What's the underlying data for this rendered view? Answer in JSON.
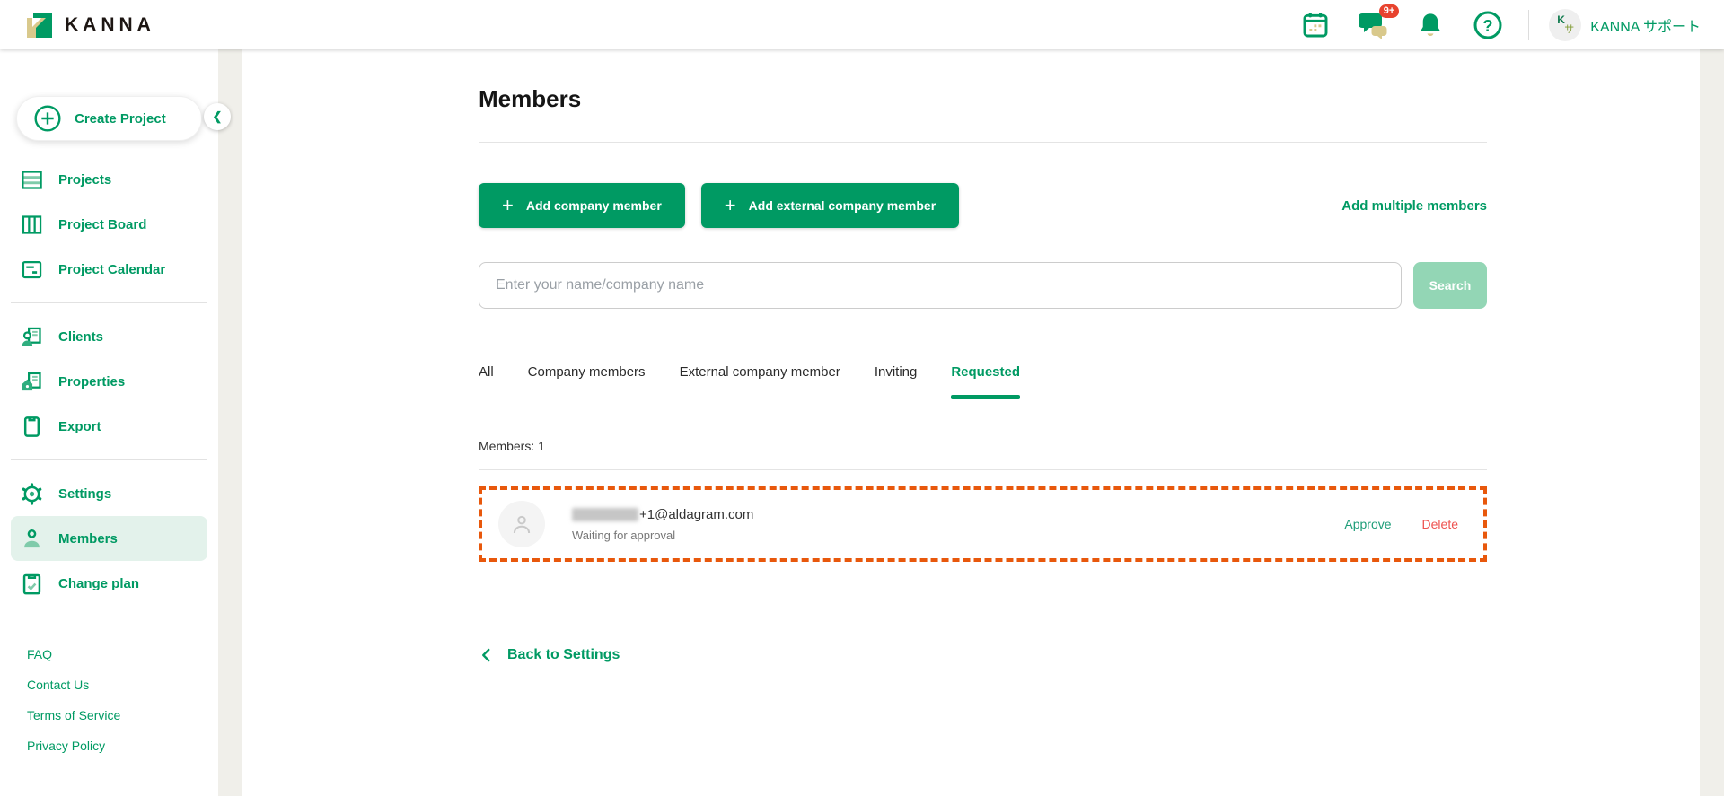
{
  "colors": {
    "brand_green": "#009A63",
    "disabled_green": "#93D6B5",
    "active_item_bg": "#E3F2EB",
    "dashed_orange": "#E8580C",
    "delete_red": "#EE5350",
    "badge_red": "#E8432E",
    "logo_tan": "#D9C98C"
  },
  "header": {
    "logo_text": "KANNA",
    "chat_badge": "9+",
    "avatar_char_1": "K",
    "avatar_char_2": "サ",
    "support_label": "KANNA サポート"
  },
  "sidebar": {
    "create_project_label": "Create Project",
    "nav_top": [
      {
        "label": "Projects",
        "icon": "projects-rows-icon"
      },
      {
        "label": "Project Board",
        "icon": "board-columns-icon"
      },
      {
        "label": "Project Calendar",
        "icon": "calendar-doc-icon"
      }
    ],
    "nav_mid": [
      {
        "label": "Clients",
        "icon": "client-person-doc-icon"
      },
      {
        "label": "Properties",
        "icon": "house-doc-icon"
      },
      {
        "label": "Export",
        "icon": "export-clipboard-icon"
      }
    ],
    "nav_bottom": [
      {
        "label": "Settings",
        "icon": "gear-icon",
        "active": false
      },
      {
        "label": "Members",
        "icon": "person-icon",
        "active": true
      },
      {
        "label": "Change plan",
        "icon": "clipboard-check-icon",
        "active": false
      }
    ],
    "footer_links": [
      {
        "label": "FAQ"
      },
      {
        "label": "Contact Us"
      },
      {
        "label": "Terms of Service"
      },
      {
        "label": "Privacy Policy"
      }
    ]
  },
  "main": {
    "title": "Members",
    "buttons": {
      "add_company_member": "Add company member",
      "add_external_company_member": "Add external company member",
      "add_multiple_members": "Add multiple members"
    },
    "search": {
      "placeholder": "Enter your name/company name",
      "button_label": "Search"
    },
    "tabs": [
      {
        "label": "All",
        "active": false
      },
      {
        "label": "Company members",
        "active": false
      },
      {
        "label": "External company member",
        "active": false
      },
      {
        "label": "Inviting",
        "active": false
      },
      {
        "label": "Requested",
        "active": true
      }
    ],
    "members_count": "Members: 1",
    "member": {
      "email_visible_suffix": "+1@aldagram.com",
      "status": "Waiting for approval",
      "approve_label": "Approve",
      "delete_label": "Delete"
    },
    "back_link_label": "Back to Settings"
  }
}
